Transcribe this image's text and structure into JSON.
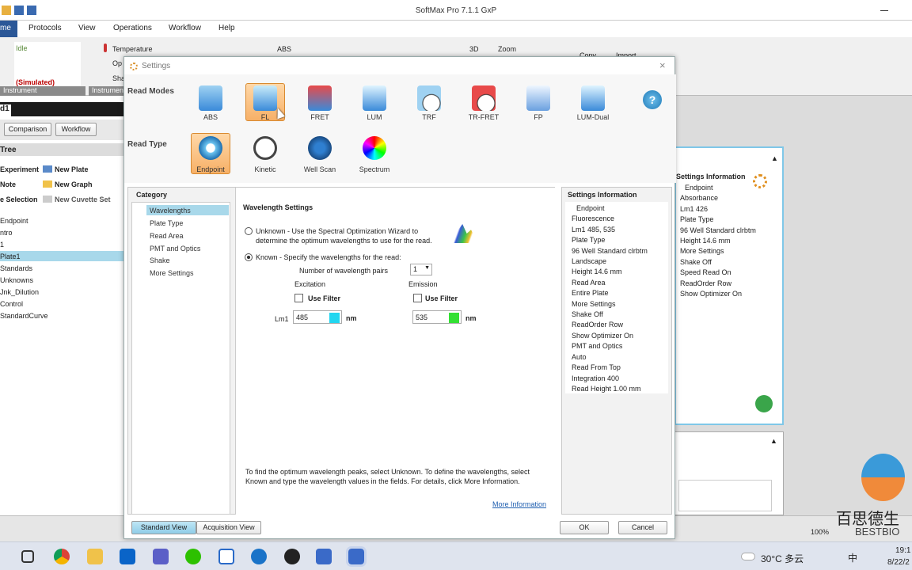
{
  "window": {
    "title": "SoftMax Pro 7.1.1 GxP"
  },
  "menu": [
    "me",
    "Protocols",
    "View",
    "Operations",
    "Workflow",
    "Help"
  ],
  "ribbon": {
    "status": "Idle",
    "simulated": "(Simulated)",
    "instrument_caption": "Instrument",
    "instrument2_caption": "Instrumen",
    "temperature": "Temperature",
    "op": "Op",
    "sha": "Sha",
    "abs_label": "ABS",
    "threed": "3D",
    "zoom": "Zoom",
    "copy": "Copy",
    "import": "Import"
  },
  "left": {
    "tab": "d1",
    "btn_comparison": "Comparison",
    "btn_workflow": "Workflow",
    "tree_title": "Tree",
    "actions": [
      "Experiment",
      "New Plate",
      "Note",
      "New Graph",
      "e Selection",
      "New Cuvette Set"
    ],
    "tree": [
      "Endpoint",
      "ntro",
      "1",
      "Plate1",
      "Standards",
      "Unknowns",
      "Jnk_Dilution",
      "Control",
      "StandardCurve"
    ]
  },
  "right": {
    "title": "Settings Information",
    "lines": [
      "Endpoint",
      "Absorbance",
      "Lm1    426",
      "Plate Type",
      "96 Well Standard clrbtm",
      "Height  14.6 mm",
      "More Settings",
      "Shake  Off",
      "Speed Read  On",
      "ReadOrder  Row",
      "Show Optimizer  On"
    ],
    "zoom": "100%"
  },
  "dialog": {
    "title": "Settings",
    "read_modes_label": "Read Modes",
    "read_type_label": "Read Type",
    "read_modes": [
      "ABS",
      "FL",
      "FRET",
      "LUM",
      "TRF",
      "TR-FRET",
      "FP",
      "LUM-Dual"
    ],
    "read_types": [
      "Endpoint",
      "Kinetic",
      "Well Scan",
      "Spectrum"
    ],
    "category_label": "Category",
    "categories": [
      "Wavelengths",
      "Plate Type",
      "Read Area",
      "PMT and Optics",
      "Shake",
      "More Settings"
    ],
    "wl_title": "Wavelength Settings",
    "unknown_text": "Unknown - Use the Spectral Optimization Wizard to",
    "unknown_text2": "determine the optimum wavelengths to use for the read.",
    "known_text": "Known - Specify the wavelengths for the read:",
    "num_pairs_label": "Number of wavelength pairs",
    "num_pairs": "1",
    "excitation": "Excitation",
    "emission": "Emission",
    "use_filter": "Use Filter",
    "lm1": "Lm1",
    "ex_value": "485",
    "em_value": "535",
    "unit": "nm",
    "footer1": "To find the optimum wavelength peaks, select Unknown. To define the wavelengths, select",
    "footer2": "Known and type the wavelength values in the fields. For details, click More Information.",
    "more_info": "More Information",
    "settings_info_title": "Settings Information",
    "settings_info": [
      "Endpoint",
      "Fluorescence",
      "Lm1    485, 535",
      "Plate Type",
      "96 Well Standard clrbtm",
      "Landscape",
      "Height  14.6 mm",
      "Read Area",
      "Entire Plate",
      "More Settings",
      "Shake  Off",
      "ReadOrder  Row",
      "Show Optimizer  On",
      "PMT and Optics",
      "Auto",
      "Read From Top",
      "Integration  400",
      "Read Height  1.00 mm"
    ],
    "standard_view": "Standard View",
    "acquisition_view": "Acquisition View",
    "ok": "OK",
    "cancel": "Cancel",
    "colors": {
      "ex": "#22d6f0",
      "em": "#33e033",
      "selected": "#f7b067"
    }
  },
  "taskbar": {
    "weather": "30°C 多云",
    "time": "19:1",
    "date": "8/22/2",
    "ime": "中"
  },
  "watermark": {
    "cn": "百思德生",
    "en": "BESTBIO"
  }
}
